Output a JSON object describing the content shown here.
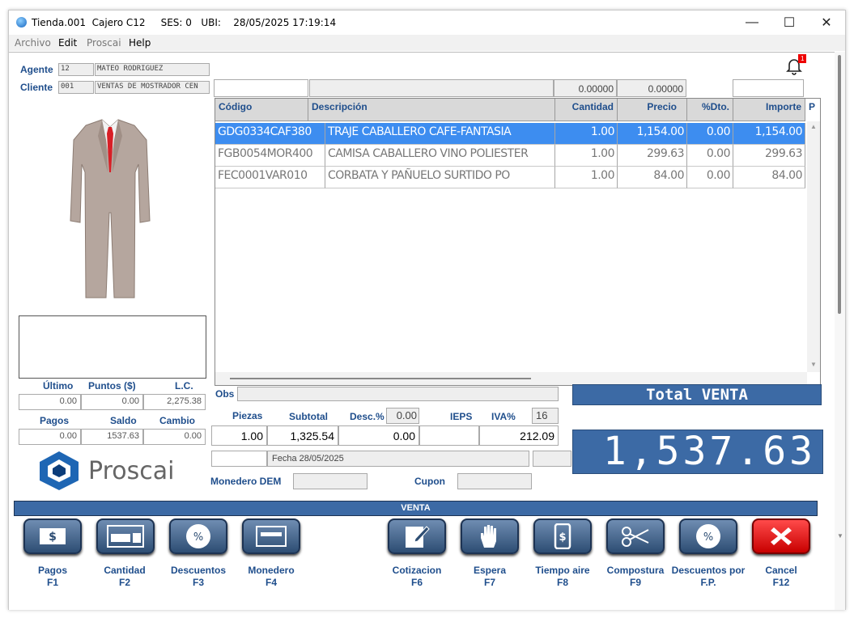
{
  "window": {
    "title": "Tienda.001  Cajero C12     SES: 0   UBI:    28/05/2025 17:19:14",
    "minimize": "—",
    "maximize": "☐",
    "close": "✕"
  },
  "menu": [
    "Archivo",
    "Edit",
    "Proscai",
    "Help"
  ],
  "notification": {
    "count": "1"
  },
  "agent": {
    "label": "Agente",
    "code": "12",
    "name": "MATEO RODRIGUEZ"
  },
  "client": {
    "label": "Cliente",
    "code": "001",
    "name": "VENTAS DE MOSTRADOR CEN"
  },
  "top_fields": {
    "qty_total": "0.00000",
    "price_total": "0.00000"
  },
  "grid": {
    "headers": [
      "Código",
      "Descripción",
      "Cantidad",
      "Precio",
      "%Dto.",
      "Importe",
      "P"
    ],
    "rows": [
      {
        "code": "GDG0334CAF380",
        "desc": "TRAJE CABALLERO CAFE-FANTASIA",
        "qty": "1.00",
        "price": "1,154.00",
        "dto": "0.00",
        "amount": "1,154.00"
      },
      {
        "code": "FGB0054MOR400",
        "desc": "CAMISA CABALLERO VINO POLIESTER",
        "qty": "1.00",
        "price": "299.63",
        "dto": "0.00",
        "amount": "299.63"
      },
      {
        "code": "FEC0001VAR010",
        "desc": "CORBATA Y PAÑUELO  SURTIDO PO",
        "qty": "1.00",
        "price": "84.00",
        "dto": "0.00",
        "amount": "84.00"
      }
    ]
  },
  "stats": {
    "ultimo_label": "Último",
    "puntos_label": "Puntos ($)",
    "lc_label": "L.C.",
    "ultimo": "0.00",
    "puntos": "0.00",
    "lc": "2,275.38",
    "pagos_label": "Pagos",
    "saldo_label": "Saldo",
    "cambio_label": "Cambio",
    "pagos": "0.00",
    "saldo": "1537.63",
    "cambio": "0.00"
  },
  "brand": "Proscai",
  "obs_label": "Obs",
  "totals": {
    "piezas_label": "Piezas",
    "subtotal_label": "Subtotal",
    "desc_label": "Desc.%",
    "desc_pct": "0.00",
    "ieps_label": "IEPS",
    "iva_label": "IVA%",
    "iva_pct": "16",
    "piezas": "1.00",
    "subtotal": "1,325.54",
    "desc": "0.00",
    "ieps": "",
    "iva": "212.09"
  },
  "fecha": "Fecha 28/05/2025",
  "monedero_label": "Monedero DEM",
  "cupon_label": "Cupon",
  "total_venta": {
    "label": "Total VENTA",
    "value": "1,537.63"
  },
  "section_label": "VENTA",
  "buttons": [
    {
      "name": "Pagos",
      "key": "F1"
    },
    {
      "name": "Cantidad",
      "key": "F2"
    },
    {
      "name": "Descuentos",
      "key": "F3"
    },
    {
      "name": "Monedero",
      "key": "F4"
    },
    {
      "name": "Cotizacion",
      "key": "F6"
    },
    {
      "name": "Espera",
      "key": "F7"
    },
    {
      "name": "Tiempo aire",
      "key": "F8"
    },
    {
      "name": "Compostura",
      "key": "F9"
    },
    {
      "name": "Descuentos por",
      "name2": "F.P.",
      "key": ""
    },
    {
      "name": "Cancel",
      "key": "F12"
    }
  ],
  "colors": {
    "accent": "#1f4e8c",
    "selection": "#3d8df0",
    "total_bg": "#3c6aa5",
    "cancel": "#e60000"
  }
}
